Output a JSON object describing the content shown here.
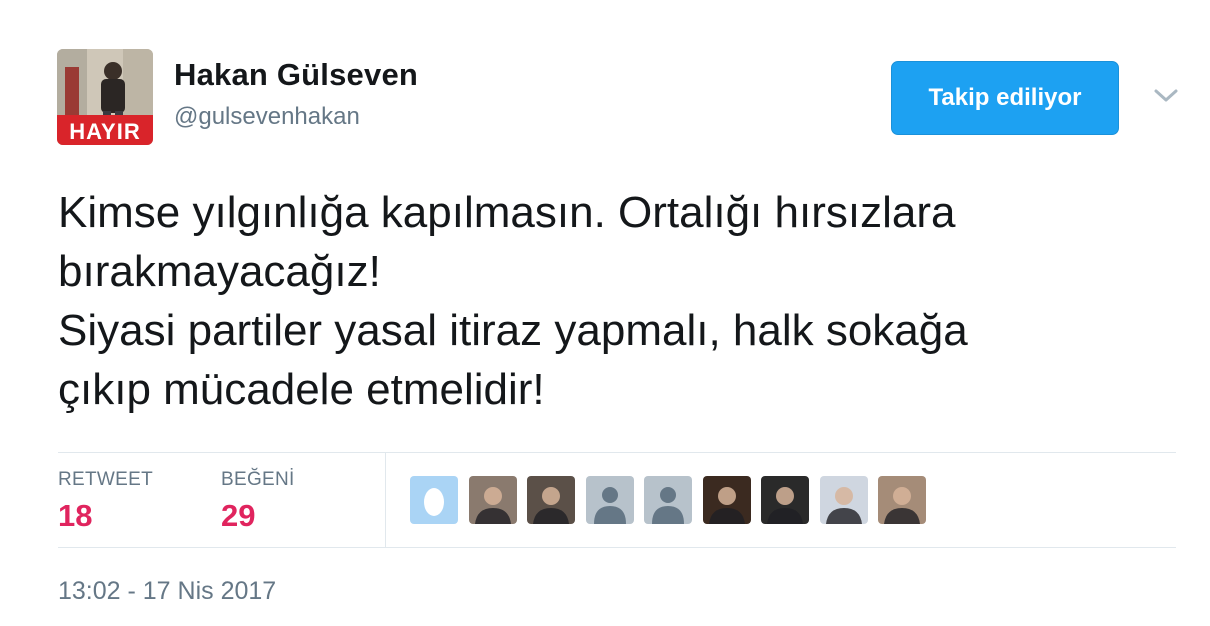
{
  "author": {
    "name": "Hakan Gülseven",
    "handle": "@gulsevenhakan",
    "avatar_text": "HAYIR"
  },
  "follow_button": {
    "label": "Takip ediliyor"
  },
  "tweet": {
    "text": "Kimse yılgınlığa kapılmasın. Ortalığı hırsızlara\nbırakmayacağız!\nSiyasi partiler yasal itiraz yapmalı, halk sokağa\nçıkıp mücadele etmelidir!"
  },
  "stats": {
    "retweet_label": "RETWEET",
    "retweet_count": "18",
    "likes_label": "BEĞENİ",
    "likes_count": "29"
  },
  "likers": [
    {
      "type": "egg",
      "color": "#aad4f5"
    },
    {
      "type": "photo",
      "color": "#8a7a6e"
    },
    {
      "type": "photo",
      "color": "#5b5048"
    },
    {
      "type": "default",
      "color": "#b7c2cb"
    },
    {
      "type": "default",
      "color": "#b7c2cb"
    },
    {
      "type": "photo",
      "color": "#3b2a20"
    },
    {
      "type": "photo",
      "color": "#2a2a2a"
    },
    {
      "type": "photo",
      "color": "#cfd6e0"
    },
    {
      "type": "photo",
      "color": "#a58c78"
    }
  ],
  "timestamp": "13:02 - 17 Nis 2017",
  "colors": {
    "accent": "#1da1f2",
    "like": "#e0245e",
    "secondary_text": "#657786"
  }
}
